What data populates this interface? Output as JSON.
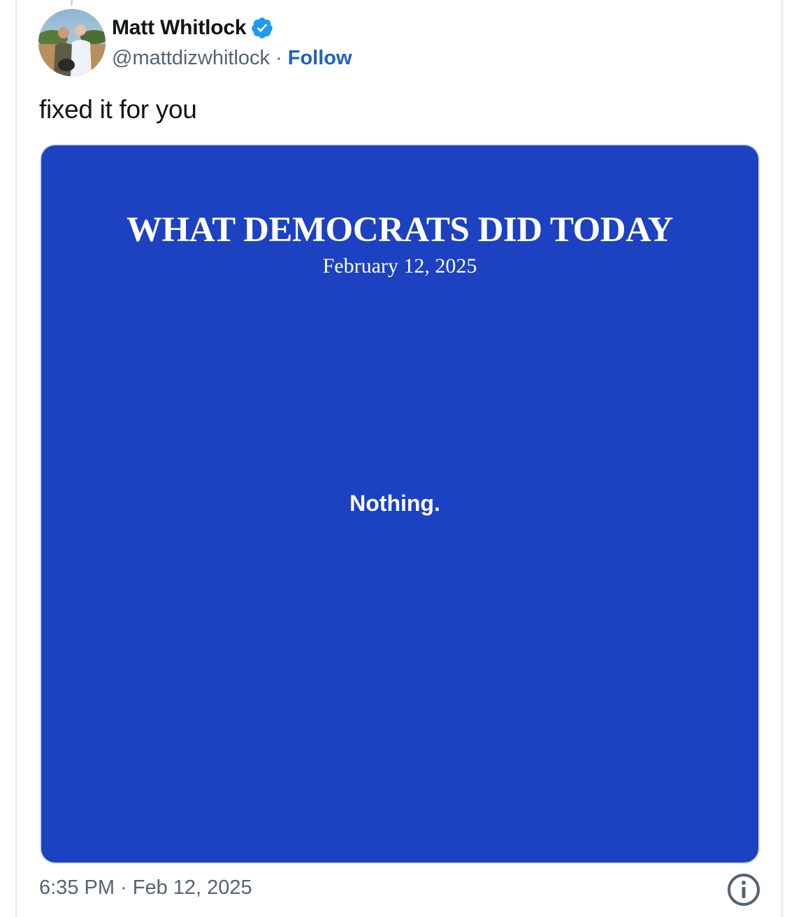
{
  "author": {
    "display_name": "Matt Whitlock",
    "handle": "@mattdizwhitlock",
    "separator": "·",
    "follow_label": "Follow",
    "verified": true
  },
  "tweet": {
    "text": "fixed it for you",
    "timestamp": "6:35 PM · Feb 12, 2025"
  },
  "media": {
    "title": "WHAT DEMOCRATS DID TODAY",
    "date": "February 12, 2025",
    "body": "Nothing.",
    "background_color": "#1c41c1"
  },
  "colors": {
    "follow_link": "#1d62c6",
    "verified_badge": "#1d9bf0",
    "secondary_text": "#536471"
  },
  "icons": {
    "verified": "verified-badge-icon",
    "info": "info-icon"
  }
}
